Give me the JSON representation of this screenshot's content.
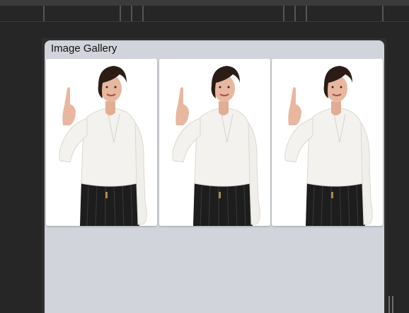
{
  "window": {
    "title": "Image Gallery"
  },
  "gallery": {
    "images": [
      {
        "subject": "woman-pointing-up"
      },
      {
        "subject": "woman-pointing-up"
      },
      {
        "subject": "woman-pointing-up"
      }
    ]
  },
  "colors": {
    "app_background": "#262626",
    "window_background": "#d1d4da",
    "blouse": "#f4f2ee",
    "trousers": "#1d1d1d",
    "hair": "#2b1d16",
    "skin": "#e8b7a0"
  }
}
